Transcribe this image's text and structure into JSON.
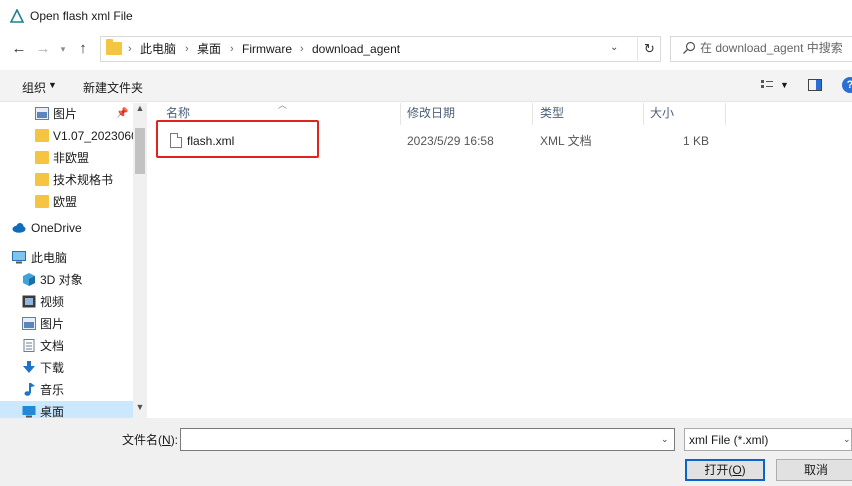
{
  "window": {
    "title": "Open flash xml File"
  },
  "address": {
    "crumbs": [
      "此电脑",
      "桌面",
      "Firmware",
      "download_agent"
    ]
  },
  "search": {
    "placeholder": "在 download_agent 中搜索"
  },
  "toolbar": {
    "organize_label": "组织",
    "new_folder_label": "新建文件夹"
  },
  "nav": {
    "items": [
      {
        "label": "图片",
        "icon": "pictures-icon",
        "pinned": true
      },
      {
        "label": "V1.07_2023060",
        "icon": "folder-icon"
      },
      {
        "label": "非欧盟",
        "icon": "folder-icon"
      },
      {
        "label": "技术规格书",
        "icon": "folder-icon"
      },
      {
        "label": "欧盟",
        "icon": "folder-icon"
      },
      {
        "label": "OneDrive",
        "icon": "cloud-icon"
      },
      {
        "label": "此电脑",
        "icon": "computer-icon"
      },
      {
        "label": "3D 对象",
        "icon": "3d-objects-icon"
      },
      {
        "label": "视频",
        "icon": "video-icon"
      },
      {
        "label": "图片",
        "icon": "pictures-icon"
      },
      {
        "label": "文档",
        "icon": "documents-icon"
      },
      {
        "label": "下载",
        "icon": "download-icon"
      },
      {
        "label": "音乐",
        "icon": "music-icon"
      },
      {
        "label": "桌面",
        "icon": "desktop-icon",
        "selected": true
      }
    ]
  },
  "list": {
    "columns": [
      "名称",
      "修改日期",
      "类型",
      "大小"
    ],
    "rows": [
      {
        "name": "flash.xml",
        "date": "2023/5/29 16:58",
        "type": "XML 文档",
        "size": "1 KB"
      }
    ]
  },
  "bottom": {
    "filename_label": "文件名",
    "filename_hotkey": "N",
    "filename_value": "",
    "filter": "xml File (*.xml)",
    "open_label": "打开",
    "open_hotkey": "O",
    "cancel_label": "取消"
  },
  "colors": {
    "accent": "#0a64ca",
    "highlight": "#e0231b",
    "folder": "#f5c542",
    "selected": "#cce8ff"
  }
}
